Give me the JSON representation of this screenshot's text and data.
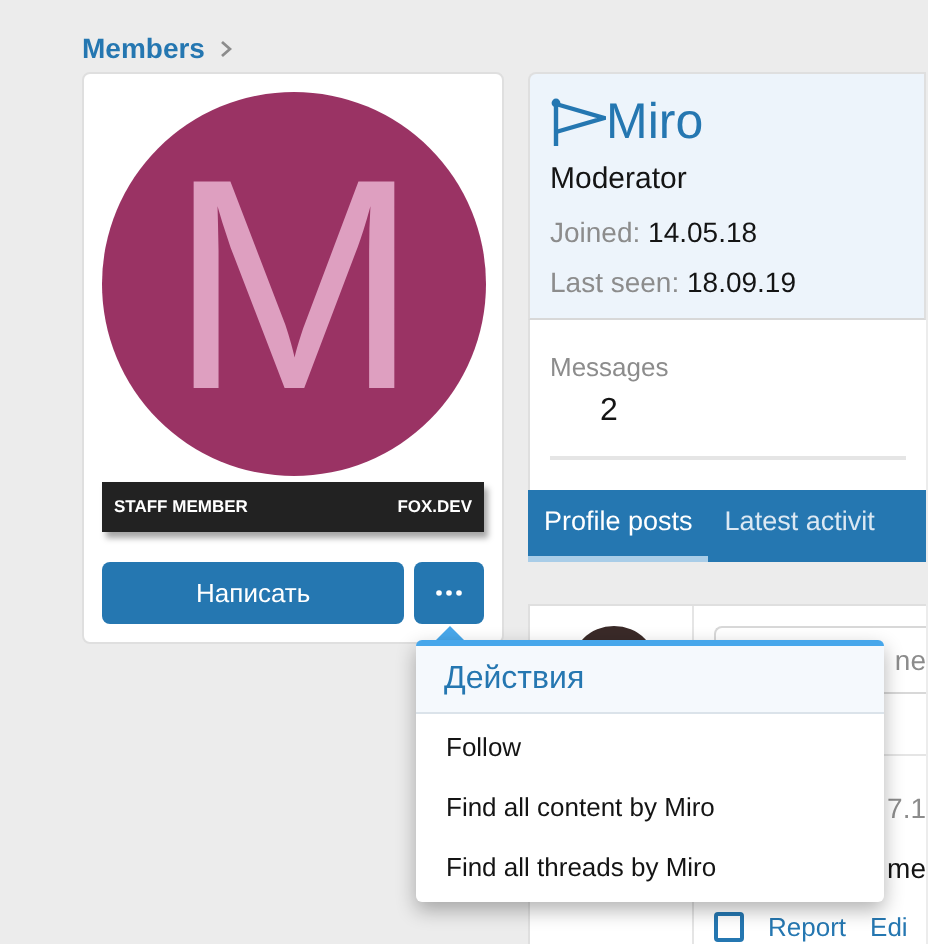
{
  "breadcrumb": [
    {
      "label": "Members"
    }
  ],
  "profile": {
    "avatar_letter": "M",
    "banner": {
      "left": "STAFF MEMBER",
      "right": "FOX.DEV"
    },
    "message_button": "Написать"
  },
  "user": {
    "name": "Miro",
    "title": "Moderator",
    "facts": [
      {
        "label": "Joined:",
        "value": "14.05.18"
      },
      {
        "label": "Last seen:",
        "value": "18.09.19"
      }
    ],
    "stats": [
      {
        "label": "Messages",
        "value": "2"
      }
    ]
  },
  "tabs": [
    {
      "label": "Profile posts",
      "selected": true
    },
    {
      "label": "Latest activit",
      "selected": false
    }
  ],
  "post": {
    "field_text": "ne",
    "fragments": [
      "7.1",
      "me"
    ],
    "checked": false,
    "actions": [
      "Report",
      "Edi"
    ]
  },
  "menu": {
    "title": "Действия",
    "items": [
      "Follow",
      "Find all content by Miro",
      "Find all threads by Miro"
    ]
  }
}
